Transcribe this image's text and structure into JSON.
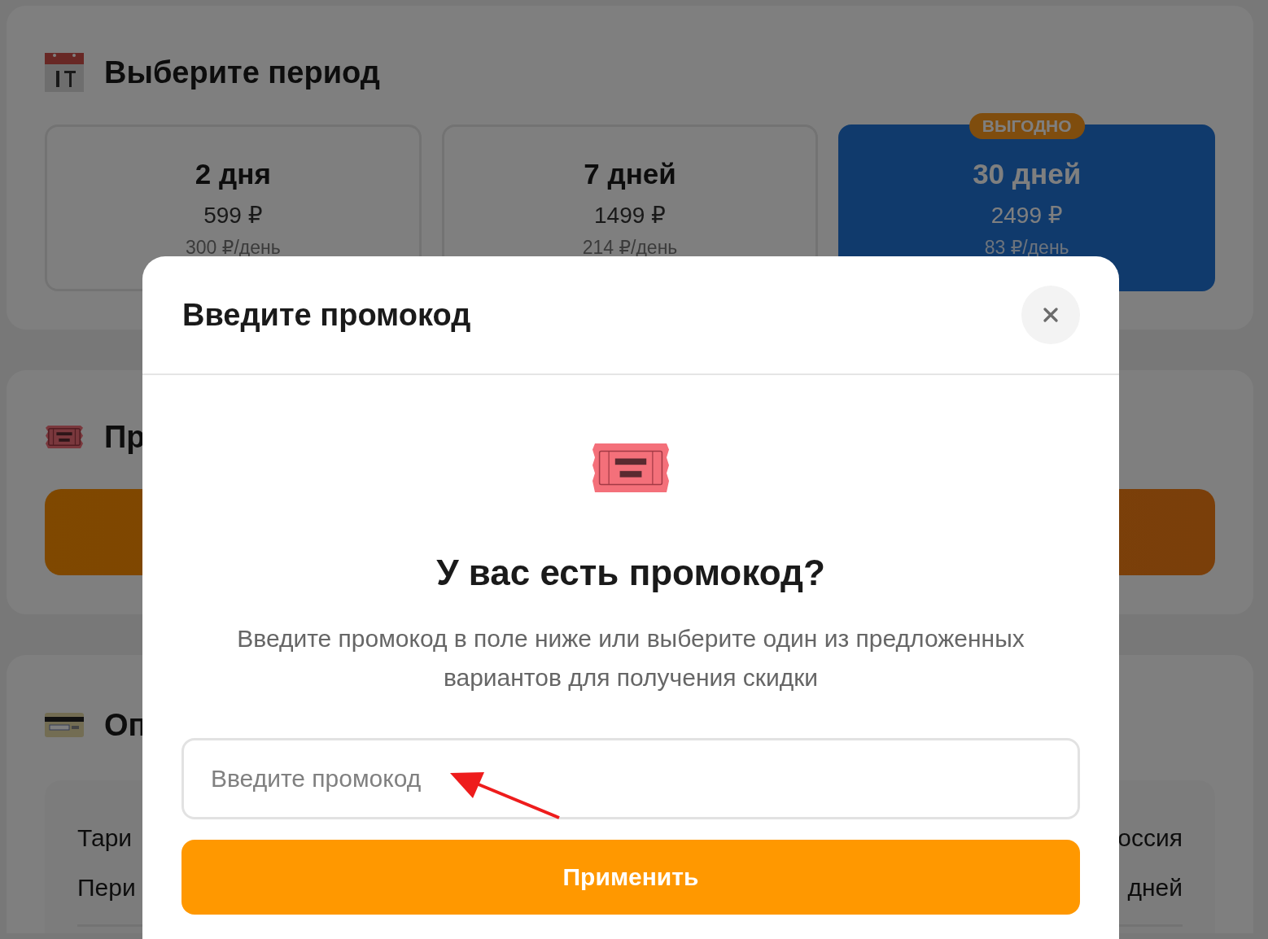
{
  "page": {
    "period_section": {
      "title": "Выберите период",
      "plans": [
        {
          "title": "2 дня",
          "price": "599 ₽",
          "per_day": "300 ₽/день",
          "selected": false
        },
        {
          "title": "7 дней",
          "price": "1499 ₽",
          "per_day": "214 ₽/день",
          "selected": false
        },
        {
          "title": "30 дней",
          "price": "2499 ₽",
          "per_day": "83 ₽/день",
          "selected": true,
          "badge": "ВЫГОДНО"
        }
      ]
    },
    "promo_section": {
      "title": "Пр"
    },
    "payment_section": {
      "title": "Оп",
      "rows": [
        {
          "label": "Тари",
          "value": "оссия"
        },
        {
          "label": "Пери",
          "value": "дней"
        }
      ]
    }
  },
  "modal": {
    "title": "Введите промокод",
    "heading": "У вас есть промокод?",
    "description": "Введите промокод в поле ниже или выберите один из предложенных вариантов для получения скидки",
    "input": {
      "placeholder": "Введите промокод"
    },
    "apply_button": "Применить"
  }
}
